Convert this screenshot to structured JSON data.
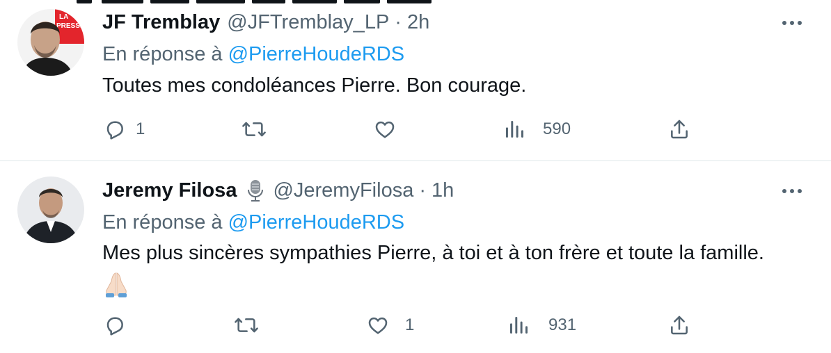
{
  "colors": {
    "text": "#0f1419",
    "secondary": "#536471",
    "link": "#1d9bf0",
    "divider": "#eff3f4",
    "background": "#ffffff"
  },
  "tweets": [
    {
      "author_name": "JF Tremblay",
      "handle": "@JFTremblay_LP",
      "separator": "·",
      "time": "2h",
      "reply_prefix": "En réponse à",
      "reply_to": "@PierreHoudeRDS",
      "text": "Toutes mes condoléances Pierre. Bon courage.",
      "avatar_badge": "LA PRESSE",
      "avatar_badge_line1": "LA",
      "avatar_badge_line2": "PRESSE",
      "badge_icon": null,
      "emoji": null,
      "actions": {
        "replies": "1",
        "retweets": "",
        "likes": "",
        "views": "590"
      },
      "icons": [
        "reply-icon",
        "retweet-icon",
        "like-icon",
        "views-icon",
        "share-icon",
        "more-icon"
      ]
    },
    {
      "author_name": "Jeremy Filosa",
      "handle": "@JeremyFilosa",
      "separator": "·",
      "time": "1h",
      "reply_prefix": "En réponse à",
      "reply_to": "@PierreHoudeRDS",
      "text": "Mes plus sincères sympathies Pierre, à toi et à ton frère et toute la famille.",
      "avatar_badge": null,
      "badge_icon": "microphone-icon",
      "emoji": "🙏🏻",
      "actions": {
        "replies": "",
        "retweets": "",
        "likes": "1",
        "views": "931"
      },
      "icons": [
        "reply-icon",
        "retweet-icon",
        "like-icon",
        "views-icon",
        "share-icon",
        "more-icon"
      ]
    }
  ]
}
